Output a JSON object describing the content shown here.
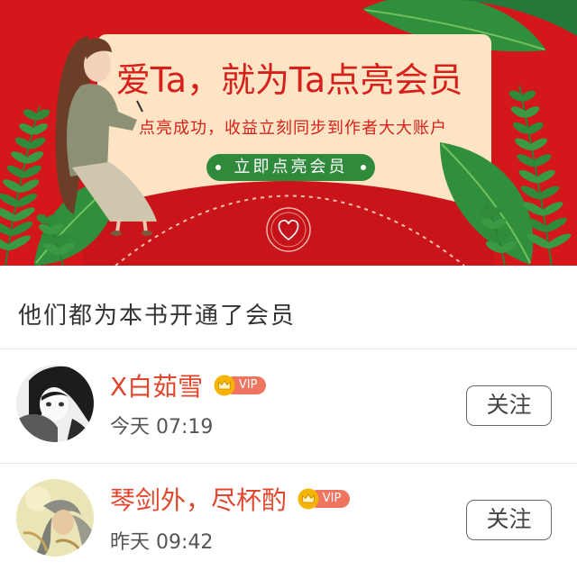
{
  "banner": {
    "title": "爱Ta，就为Ta点亮会员",
    "subtitle": "点亮成功，收益立刻同步到作者大大账户",
    "button_label": "立即点亮会员"
  },
  "section_title": "他们都为本书开通了会员",
  "members": [
    {
      "name": "X白茹雪",
      "vip_label": "VIP",
      "time": "今天 07:19",
      "follow_label": "关注",
      "avatar_icon": "avatar-anime-girl-bw"
    },
    {
      "name": "琴剑外，尽杯酌",
      "vip_label": "VIP",
      "time": "昨天 09:42",
      "follow_label": "关注",
      "avatar_icon": "avatar-painting-yellow"
    }
  ],
  "colors": {
    "banner_red": "#d3171b",
    "envelope_front": "#c91419",
    "card_cream": "#fde4c4",
    "banner_text": "#d6201c",
    "button_green": "#2f8b3b",
    "leaf_green": "#2f8f3c",
    "member_name": "#e2462c",
    "vip_pill": "#ef7560",
    "crown_yellow": "#f5b400"
  }
}
